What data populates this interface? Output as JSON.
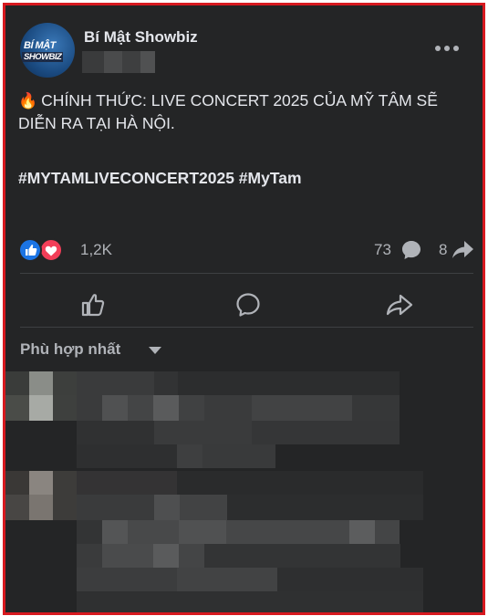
{
  "post": {
    "author": "Bí Mật Showbiz",
    "avatar": {
      "logo_line1": "BÍ MẬT",
      "logo_line2": "SHOWBIZ"
    },
    "fire_emoji": "🔥",
    "text": "CHÍNH THỨC: LIVE CONCERT 2025 CỦA MỸ TÂM SẼ DIỄN RA TẠI HÀ NỘI.",
    "hashtags": "#MYTAMLIVECONCERT2025 #MyTam"
  },
  "stats": {
    "reaction_count": "1,2K",
    "comment_count": "73",
    "share_count": "8"
  },
  "icons": {
    "more": "more-horizontal-icon",
    "like": "thumbs-up-icon",
    "comment": "comment-bubble-icon",
    "share": "share-arrow-icon"
  },
  "comments": {
    "sort_label": "Phù hợp nhất"
  },
  "colors": {
    "background": "#242526",
    "text_primary": "#e4e6eb",
    "text_secondary": "#b0b3b8",
    "like_blue": "#1b74e4",
    "love_red": "#f33e58",
    "frame_border": "#d7191f"
  }
}
